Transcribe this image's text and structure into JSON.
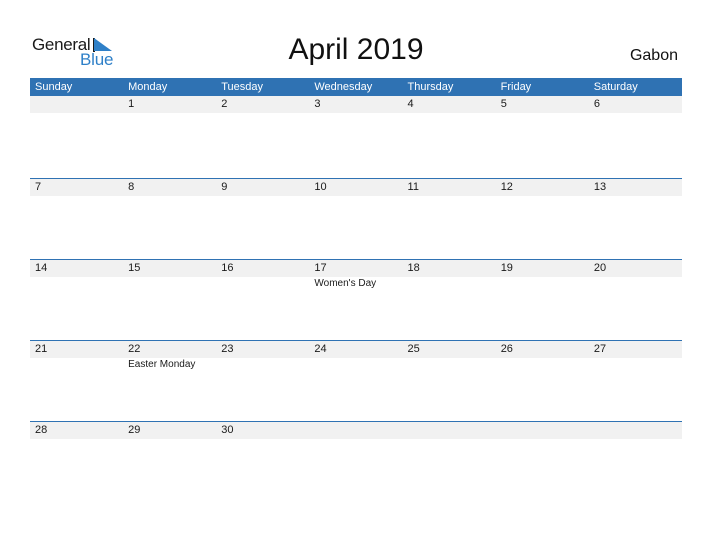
{
  "logo": {
    "general": "General",
    "blue": "Blue"
  },
  "title": "April 2019",
  "country": "Gabon",
  "colors": {
    "accent": "#2f72b3",
    "logo_blue": "#2f80c8",
    "date_strip": "#f1f1f1"
  },
  "weekdays": [
    "Sunday",
    "Monday",
    "Tuesday",
    "Wednesday",
    "Thursday",
    "Friday",
    "Saturday"
  ],
  "weeks": [
    [
      {
        "d": ""
      },
      {
        "d": "1"
      },
      {
        "d": "2"
      },
      {
        "d": "3"
      },
      {
        "d": "4"
      },
      {
        "d": "5"
      },
      {
        "d": "6"
      }
    ],
    [
      {
        "d": "7"
      },
      {
        "d": "8"
      },
      {
        "d": "9"
      },
      {
        "d": "10"
      },
      {
        "d": "11"
      },
      {
        "d": "12"
      },
      {
        "d": "13"
      }
    ],
    [
      {
        "d": "14"
      },
      {
        "d": "15"
      },
      {
        "d": "16"
      },
      {
        "d": "17",
        "h": "Women's Day"
      },
      {
        "d": "18"
      },
      {
        "d": "19"
      },
      {
        "d": "20"
      }
    ],
    [
      {
        "d": "21"
      },
      {
        "d": "22",
        "h": "Easter Monday"
      },
      {
        "d": "23"
      },
      {
        "d": "24"
      },
      {
        "d": "25"
      },
      {
        "d": "26"
      },
      {
        "d": "27"
      }
    ],
    [
      {
        "d": "28"
      },
      {
        "d": "29"
      },
      {
        "d": "30"
      },
      {
        "d": ""
      },
      {
        "d": ""
      },
      {
        "d": ""
      },
      {
        "d": ""
      }
    ]
  ]
}
